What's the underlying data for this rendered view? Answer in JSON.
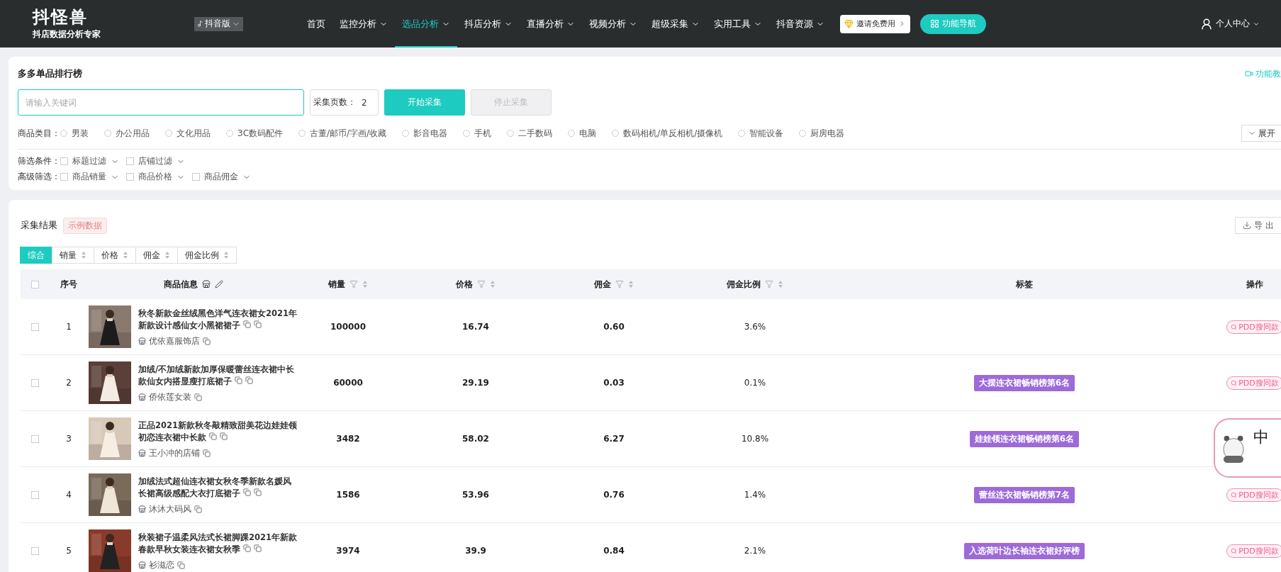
{
  "header": {
    "logo": "抖怪兽",
    "slogan": "抖店数据分析专家",
    "version": "抖音版",
    "nav": [
      {
        "label": "首页",
        "dropdown": false,
        "selected": false
      },
      {
        "label": "监控分析",
        "dropdown": true,
        "selected": false
      },
      {
        "label": "选品分析",
        "dropdown": true,
        "selected": true
      },
      {
        "label": "抖店分析",
        "dropdown": true,
        "selected": false
      },
      {
        "label": "直播分析",
        "dropdown": true,
        "selected": false
      },
      {
        "label": "视频分析",
        "dropdown": true,
        "selected": false
      },
      {
        "label": "超级采集",
        "dropdown": true,
        "selected": false
      },
      {
        "label": "实用工具",
        "dropdown": true,
        "selected": false
      },
      {
        "label": "抖音资源",
        "dropdown": true,
        "selected": false
      }
    ],
    "invite_button": "邀请免费用",
    "guide_button": "功能导航",
    "user": "个人中心"
  },
  "search_panel": {
    "title": "多多单品排行榜",
    "tutorial_link": "功能教",
    "keyword": {
      "placeholder": "请输入关键词"
    },
    "pages": {
      "label": "采集页数：",
      "value": "2"
    },
    "start_button": {
      "label": "开始采集",
      "disabled": false
    },
    "stop_button": {
      "label": "停止采集",
      "disabled": true
    },
    "category_label": "商品类目：",
    "categories": [
      {
        "label": "男装",
        "selected": false
      },
      {
        "label": "办公用品",
        "selected": false
      },
      {
        "label": "文化用品",
        "selected": false
      },
      {
        "label": "3C数码配件",
        "selected": false
      },
      {
        "label": "古董/邮币/字画/收藏",
        "selected": false
      },
      {
        "label": "影音电器",
        "selected": false
      },
      {
        "label": "手机",
        "selected": false
      },
      {
        "label": "二手数码",
        "selected": false
      },
      {
        "label": "电脑",
        "selected": false
      },
      {
        "label": "数码相机/单反相机/摄像机",
        "selected": false
      },
      {
        "label": "智能设备",
        "selected": false
      },
      {
        "label": "厨房电器",
        "selected": false
      }
    ],
    "expand_button": "展开",
    "filter_rows": [
      {
        "label": "筛选条件：",
        "options": [
          {
            "label": "标题过滤",
            "checked": false
          },
          {
            "label": "店铺过滤",
            "checked": false
          }
        ]
      },
      {
        "label": "高级筛选：",
        "options": [
          {
            "label": "商品销量",
            "checked": false
          },
          {
            "label": "商品价格",
            "checked": false
          },
          {
            "label": "商品佣金",
            "checked": false
          }
        ]
      }
    ]
  },
  "results": {
    "title": "采集结果",
    "badge": "示例数据",
    "export_button": "导 出",
    "sort_tabs": [
      {
        "label": "综合",
        "sortable": false,
        "selected": true
      },
      {
        "label": "销量",
        "sortable": true,
        "selected": false
      },
      {
        "label": "价格",
        "sortable": true,
        "selected": false
      },
      {
        "label": "佣金",
        "sortable": true,
        "selected": false
      },
      {
        "label": "佣金比例",
        "sortable": true,
        "selected": false
      }
    ],
    "table": {
      "all_checked": false,
      "columns": [
        {
          "label": "序号",
          "kind": "plain"
        },
        {
          "label": "商品信息",
          "kind": "edit"
        },
        {
          "label": "销量",
          "kind": "filter"
        },
        {
          "label": "价格",
          "kind": "filter"
        },
        {
          "label": "佣金",
          "kind": "filter"
        },
        {
          "label": "佣金比例",
          "kind": "filter"
        },
        {
          "label": "标签",
          "kind": "plain"
        },
        {
          "label": "操作",
          "kind": "plain"
        }
      ],
      "rows": [
        {
          "checked": false,
          "index": "1",
          "title": "秋冬新款金丝绒黑色洋气连衣裙女2021年新款设计感仙女小黑裙裙子",
          "shop": "优依嘉服饰店",
          "sales": "100000",
          "price": "16.74",
          "commission": "0.60",
          "ratio": "3.6%",
          "action": "PDD搜同款"
        },
        {
          "checked": false,
          "index": "2",
          "title": "加绒/不加绒新款加厚保暖蕾丝连衣裙中长款仙女内搭显瘦打底裙子",
          "shop": "侨依莲女装",
          "sales": "60000",
          "price": "29.19",
          "commission": "0.03",
          "ratio": "0.1%",
          "tag": "大摆连衣裙畅销榜第6名",
          "action": "PDD搜同款"
        },
        {
          "checked": false,
          "index": "3",
          "title": "正品2021新款秋冬敲精致甜美花边娃娃领初恋连衣裙中长款",
          "shop": "王小冲的店铺",
          "sales": "3482",
          "price": "58.02",
          "commission": "6.27",
          "ratio": "10.8%",
          "tag": "娃娃领连衣裙畅销榜第6名"
        },
        {
          "checked": false,
          "index": "4",
          "title": "加绒法式超仙连衣裙女秋冬季新款名媛风长裙高级感配大衣打底裙子",
          "shop": "沐沐大码风",
          "sales": "1586",
          "price": "53.96",
          "commission": "0.76",
          "ratio": "1.4%",
          "tag": "蕾丝连衣裙畅销榜第7名",
          "action": "PDD搜同款"
        },
        {
          "checked": false,
          "index": "5",
          "title": "秋装裙子温柔风法式长裙脚踝2021年新款春款早秋女装连衣裙女秋季",
          "shop": "衫滋恋",
          "sales": "3974",
          "price": "39.9",
          "commission": "0.84",
          "ratio": "2.1%",
          "tag": "入选荷叶边长袖连衣裙好评榜",
          "action": "PDD搜同款"
        }
      ]
    }
  },
  "floating_widget": {
    "label": "中"
  }
}
